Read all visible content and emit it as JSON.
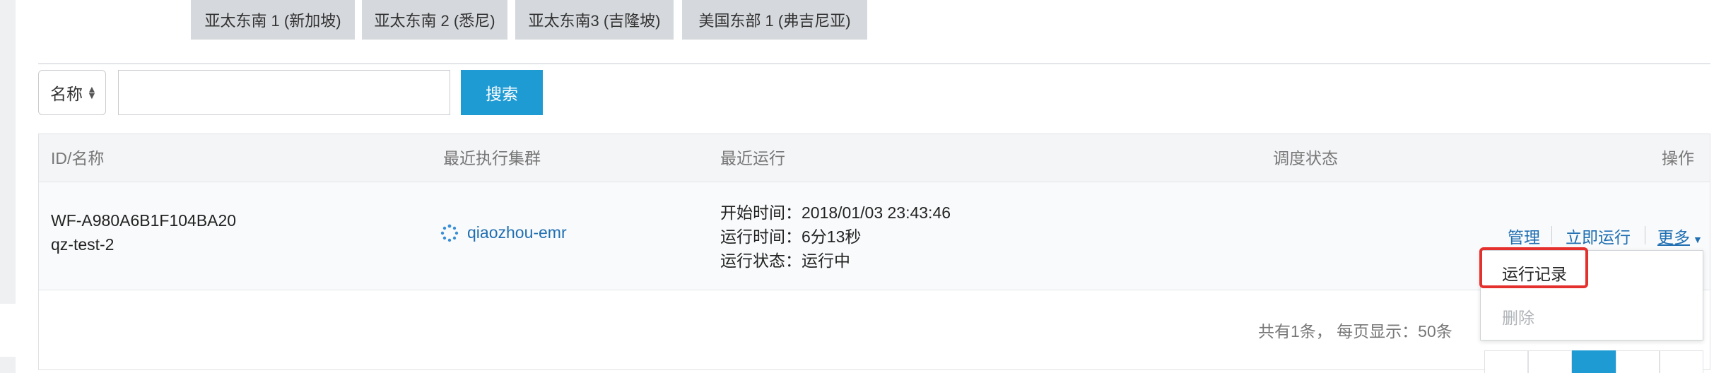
{
  "region_tabs": [
    {
      "label": "亚太东南 1 (新加坡)"
    },
    {
      "label": "亚太东南 2 (悉尼)"
    },
    {
      "label": "亚太东南3 (吉隆坡)"
    },
    {
      "label": "美国东部 1 (弗吉尼亚)"
    }
  ],
  "search": {
    "field_select": "名称",
    "input_value": "",
    "button_label": "搜索"
  },
  "table": {
    "headers": {
      "id_name": "ID/名称",
      "cluster": "最近执行集群",
      "last_run": "最近运行",
      "schedule_status": "调度状态",
      "actions": "操作"
    },
    "rows": [
      {
        "id": "WF-A980A6B1F104BA20",
        "name": "qz-test-2",
        "cluster": "qiaozhou-emr",
        "start_time": "开始时间：2018/01/03 23:43:46",
        "run_time": "运行时间：6分13秒",
        "run_status": "运行状态：运行中",
        "schedule_status": "",
        "actions": {
          "manage": "管理",
          "run_now": "立即运行",
          "more": "更多"
        }
      }
    ]
  },
  "pagination": {
    "summary": "共有1条，  每页显示：50条"
  },
  "more_menu": {
    "items": [
      {
        "label": "运行记录",
        "enabled": true
      },
      {
        "label": "删除",
        "enabled": false
      }
    ]
  },
  "colors": {
    "accent": "#1f9bd4",
    "link": "#1f6fb2",
    "highlight": "#e5312e"
  }
}
